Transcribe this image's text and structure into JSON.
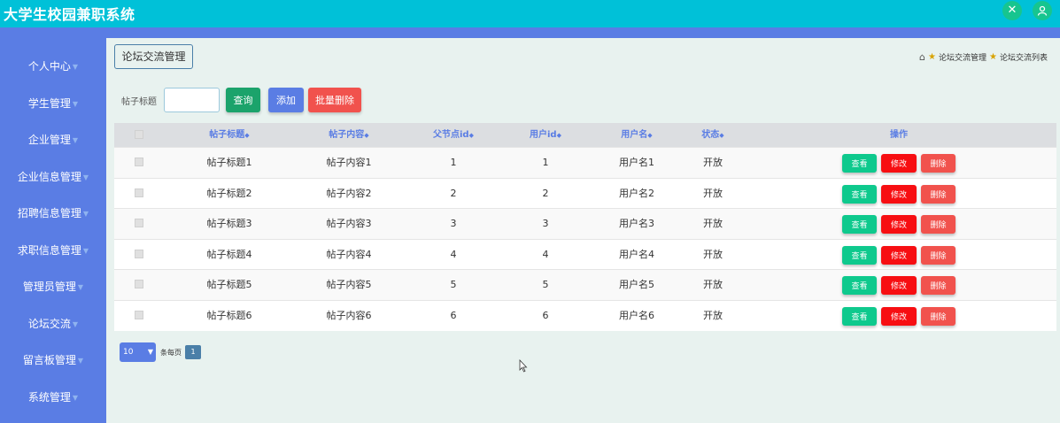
{
  "app": {
    "title": "大学生校园兼职系统"
  },
  "topbar": {
    "icons": [
      "shuffle-icon",
      "user-icon"
    ]
  },
  "sidebar": {
    "items": [
      {
        "label": "个人中心"
      },
      {
        "label": "学生管理"
      },
      {
        "label": "企业管理"
      },
      {
        "label": "企业信息管理"
      },
      {
        "label": "招聘信息管理"
      },
      {
        "label": "求职信息管理"
      },
      {
        "label": "管理员管理"
      },
      {
        "label": "论坛交流"
      },
      {
        "label": "留言板管理"
      },
      {
        "label": "系统管理"
      }
    ]
  },
  "page": {
    "heading": "论坛交流管理",
    "breadcrumb": [
      "论坛交流管理",
      "论坛交流列表"
    ]
  },
  "search": {
    "label": "帖子标题",
    "value": "",
    "search_button": "查询",
    "add_button": "添加",
    "batch_delete_button": "批量删除"
  },
  "table": {
    "headers": [
      "帖子标题",
      "帖子内容",
      "父节点id",
      "用户id",
      "用户名",
      "状态",
      "操作"
    ],
    "sort_icon": "sort-icon",
    "rows": [
      {
        "title": "帖子标题1",
        "content": "帖子内容1",
        "parentid": "1",
        "userid": "1",
        "username": "用户名1",
        "status": "开放"
      },
      {
        "title": "帖子标题2",
        "content": "帖子内容2",
        "parentid": "2",
        "userid": "2",
        "username": "用户名2",
        "status": "开放"
      },
      {
        "title": "帖子标题3",
        "content": "帖子内容3",
        "parentid": "3",
        "userid": "3",
        "username": "用户名3",
        "status": "开放"
      },
      {
        "title": "帖子标题4",
        "content": "帖子内容4",
        "parentid": "4",
        "userid": "4",
        "username": "用户名4",
        "status": "开放"
      },
      {
        "title": "帖子标题5",
        "content": "帖子内容5",
        "parentid": "5",
        "userid": "5",
        "username": "用户名5",
        "status": "开放"
      },
      {
        "title": "帖子标题6",
        "content": "帖子内容6",
        "parentid": "6",
        "userid": "6",
        "username": "用户名6",
        "status": "开放"
      }
    ],
    "actions": {
      "view": "查看",
      "edit": "修改",
      "delete": "删除"
    }
  },
  "pagination": {
    "page_size": "10",
    "per_page_label": "条每页",
    "current_page": "1"
  },
  "colors": {
    "topbar": "#00c1d8",
    "sidebar": "#5a7de4",
    "view": "#0ec98d",
    "edit": "#f70e12",
    "delete": "#f1524d"
  }
}
